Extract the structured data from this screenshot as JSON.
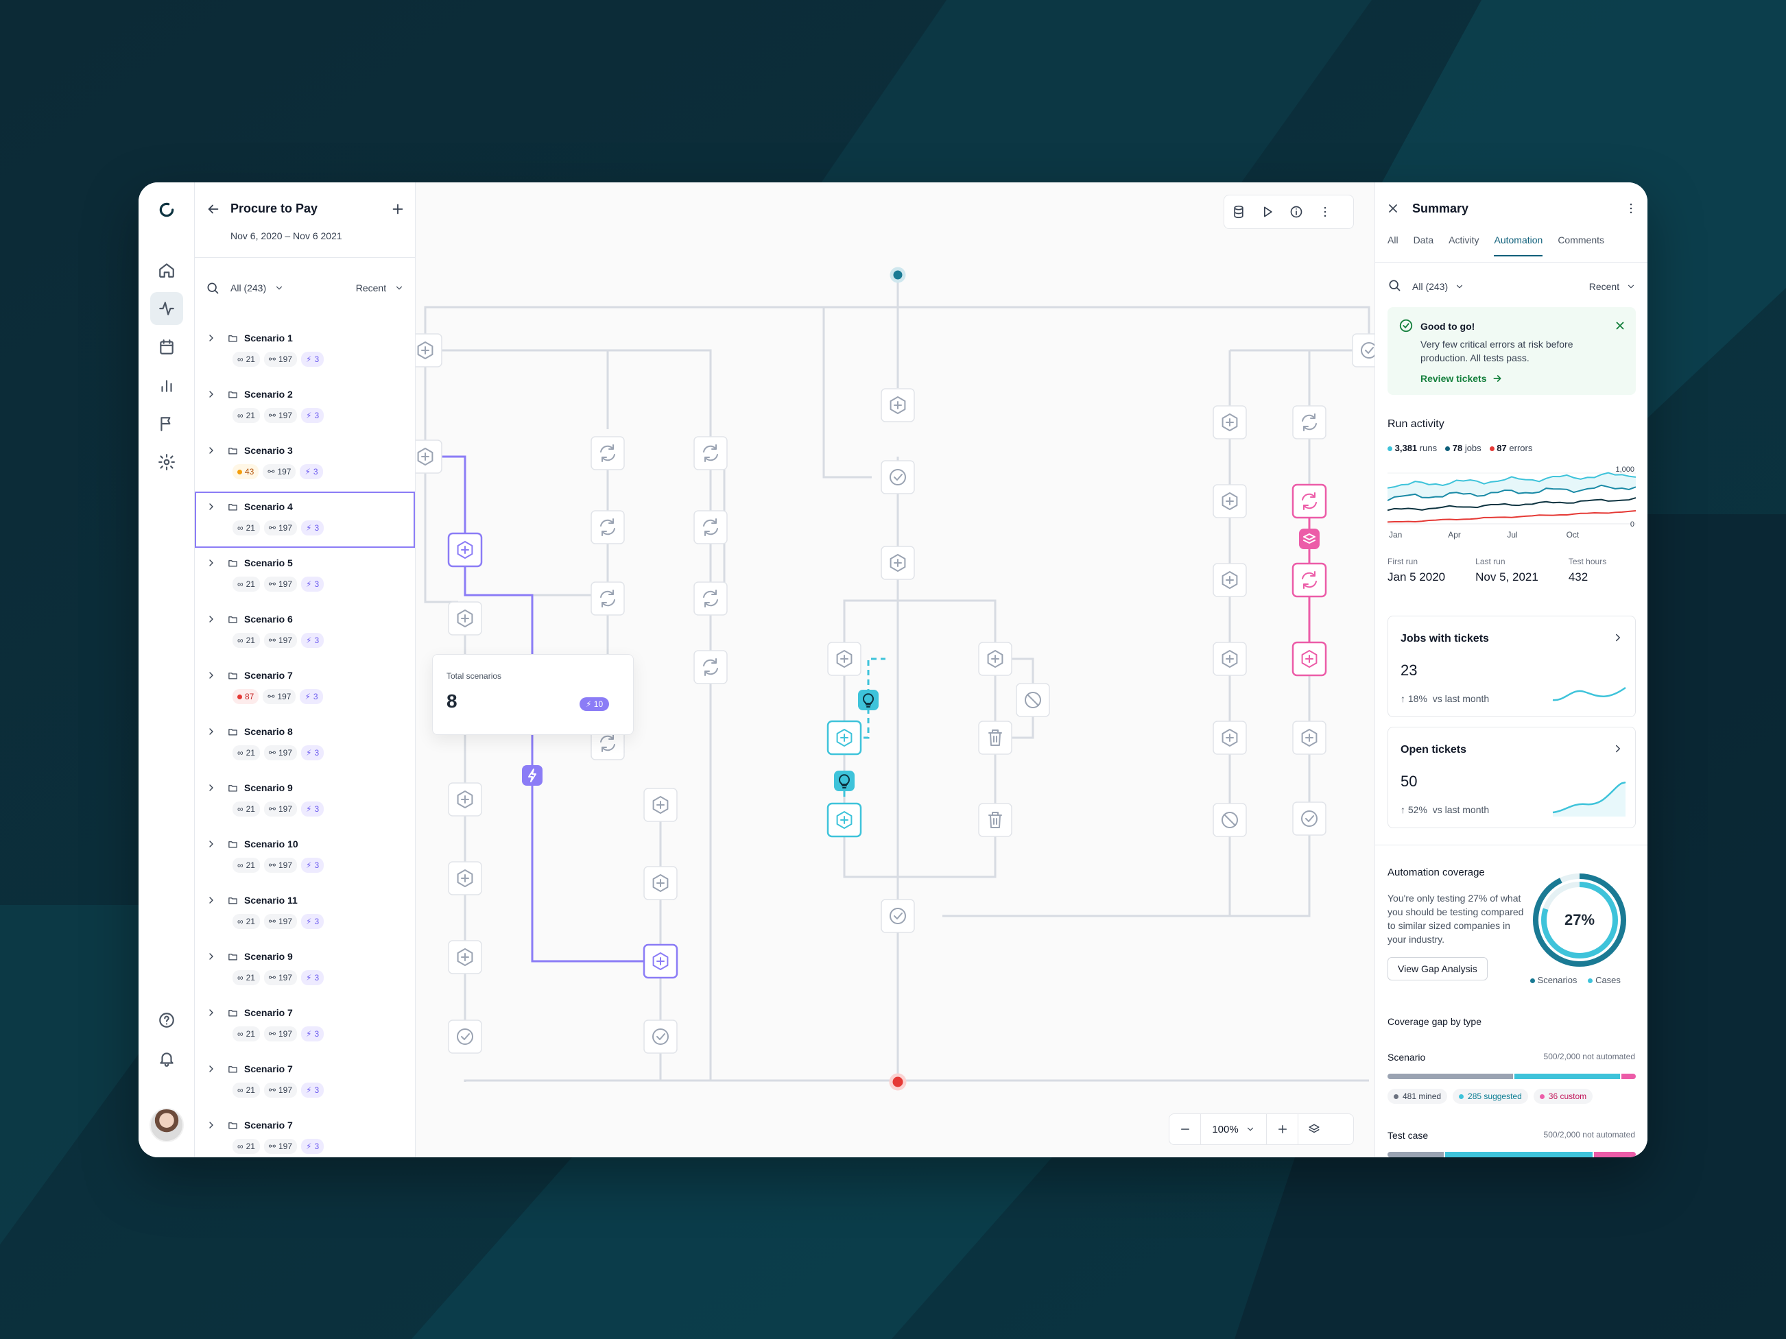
{
  "colors": {
    "accent": "#0e5f7a",
    "purple": "#8b7cf6",
    "cyan": "#3ec3da",
    "pink": "#ec5ca8",
    "red": "#e53935",
    "green": "#15803d"
  },
  "rail": {
    "icons": [
      "logo-icon",
      "home-icon",
      "activity-icon",
      "calendar-icon",
      "bar-chart-icon",
      "flag-icon",
      "settings-icon",
      "help-icon",
      "bell-icon"
    ],
    "active": "activity-icon"
  },
  "panel": {
    "title": "Procure to Pay",
    "date_range": "Nov 6, 2020 – Nov 6 2021",
    "filter_all": "All (243)",
    "filter_sort": "Recent",
    "scenarios": [
      {
        "name": "Scenario 1",
        "a": "21",
        "a_status": "neutral",
        "b": "197",
        "c": "3"
      },
      {
        "name": "Scenario 2",
        "a": "21",
        "a_status": "neutral",
        "b": "197",
        "c": "3"
      },
      {
        "name": "Scenario 3",
        "a": "43",
        "a_status": "warning",
        "b": "197",
        "c": "3"
      },
      {
        "name": "Scenario 4",
        "a": "21",
        "a_status": "neutral",
        "b": "197",
        "c": "3",
        "selected": true
      },
      {
        "name": "Scenario 5",
        "a": "21",
        "a_status": "neutral",
        "b": "197",
        "c": "3"
      },
      {
        "name": "Scenario 6",
        "a": "21",
        "a_status": "neutral",
        "b": "197",
        "c": "3"
      },
      {
        "name": "Scenario 7",
        "a": "87",
        "a_status": "error",
        "b": "197",
        "c": "3"
      },
      {
        "name": "Scenario 8",
        "a": "21",
        "a_status": "neutral",
        "b": "197",
        "c": "3"
      },
      {
        "name": "Scenario 9",
        "a": "21",
        "a_status": "neutral",
        "b": "197",
        "c": "3"
      },
      {
        "name": "Scenario 10",
        "a": "21",
        "a_status": "neutral",
        "b": "197",
        "c": "3"
      },
      {
        "name": "Scenario 11",
        "a": "21",
        "a_status": "neutral",
        "b": "197",
        "c": "3"
      },
      {
        "name": "Scenario 9",
        "a": "21",
        "a_status": "neutral",
        "b": "197",
        "c": "3"
      },
      {
        "name": "Scenario 7",
        "a": "21",
        "a_status": "neutral",
        "b": "197",
        "c": "3"
      },
      {
        "name": "Scenario 7",
        "a": "21",
        "a_status": "neutral",
        "b": "197",
        "c": "3"
      },
      {
        "name": "Scenario 7",
        "a": "21",
        "a_status": "neutral",
        "b": "197",
        "c": "3"
      }
    ]
  },
  "canvas": {
    "toolbar": [
      "database-icon",
      "play-icon",
      "info-icon",
      "more-vertical-icon"
    ],
    "tooltip": {
      "label": "Total scenarios",
      "value": "8",
      "badge": "10"
    },
    "zoom": {
      "value": "100%"
    }
  },
  "summary": {
    "title": "Summary",
    "tabs": [
      "All",
      "Data",
      "Activity",
      "Automation",
      "Comments"
    ],
    "active_tab": "Automation",
    "filter_all": "All (243)",
    "filter_sort": "Recent",
    "alert": {
      "title": "Good to go!",
      "text": "Very few critical errors at risk before production. All tests pass.",
      "link": "Review tickets"
    },
    "run_activity": {
      "title": "Run activity",
      "runs": "3,381",
      "runs_label": "runs",
      "jobs": "78",
      "jobs_label": "jobs",
      "errors": "87",
      "errors_label": "errors",
      "y_max": "1,000",
      "y_min": "0",
      "months": [
        "Jan",
        "Apr",
        "Jul",
        "Oct"
      ]
    },
    "stats": [
      {
        "label": "First run",
        "value": "Jan 5 2020"
      },
      {
        "label": "Last run",
        "value": "Nov 5, 2021"
      },
      {
        "label": "Test hours",
        "value": "432"
      }
    ],
    "jobs_card": {
      "title": "Jobs with tickets",
      "value": "23",
      "change": "18%",
      "change_label": "vs last month"
    },
    "tickets_card": {
      "title": "Open tickets",
      "value": "50",
      "change": "52%",
      "change_label": "vs last month"
    },
    "coverage": {
      "title": "Automation coverage",
      "text": "You're only testing 27% of what you should be testing compared to similar sized companies in your industry.",
      "percent": "27%",
      "percent_value": 27,
      "button": "View Gap Analysis",
      "legend": [
        "Scenarios",
        "Cases"
      ]
    },
    "gap": {
      "title": "Coverage gap by type",
      "rows": [
        {
          "label": "Scenario",
          "note": "500/2,000 not automated",
          "chips": [
            {
              "text": "481 mined",
              "color": "#6b7280"
            },
            {
              "text": "285 suggested",
              "color": "#3ec3da"
            },
            {
              "text": "36 custom",
              "color": "#ec5ca8"
            }
          ],
          "segments": [
            0.51,
            0.43,
            0.06
          ]
        },
        {
          "label": "Test case",
          "note": "500/2,000 not automated",
          "segments": [
            0.23,
            0.6,
            0.17
          ]
        }
      ]
    }
  }
}
